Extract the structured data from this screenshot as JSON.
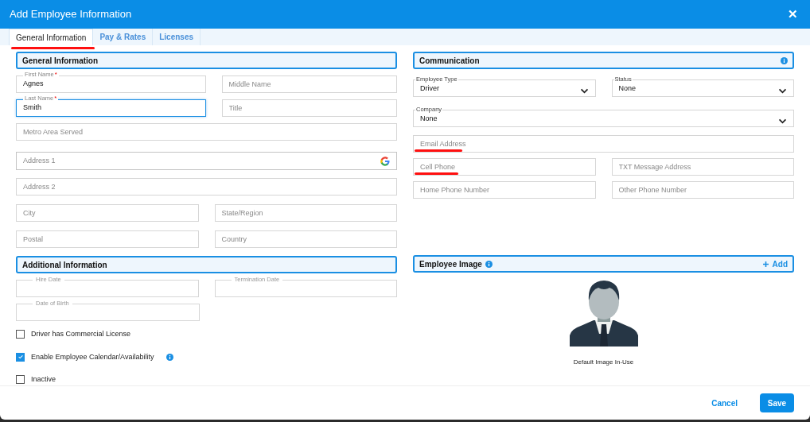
{
  "dialog": {
    "title": "Add Employee Information",
    "close": "✕"
  },
  "tabs": [
    {
      "label": "General Information",
      "selected": true,
      "marked": true
    },
    {
      "label": "Pay & Rates",
      "selected": false,
      "marked": false
    },
    {
      "label": "Licenses",
      "selected": false,
      "marked": false
    }
  ],
  "general": {
    "heading": "General Information",
    "rows": [
      [
        {
          "kind": "labeled",
          "label": "First Name",
          "value": "Agnes",
          "required_mark": "*",
          "focused": false
        },
        {
          "kind": "text",
          "placeholder": "Middle Name",
          "marked": false
        }
      ],
      [
        {
          "kind": "labeled",
          "label": "Last Name",
          "value": "Smith",
          "required_mark": "*",
          "focused": true
        },
        {
          "kind": "text",
          "placeholder": "Title",
          "marked": false
        }
      ],
      [
        {
          "kind": "text",
          "placeholder": "Metro Area Served",
          "marked": false
        }
      ],
      [
        {
          "kind": "lookup",
          "placeholder": "Address 1"
        }
      ],
      [
        {
          "kind": "text",
          "placeholder": "Address 2",
          "marked": false
        }
      ],
      [
        {
          "kind": "text",
          "placeholder": "City",
          "marked": false
        },
        {
          "kind": "text",
          "placeholder": "State/Region",
          "marked": false
        }
      ],
      [
        {
          "kind": "text",
          "placeholder": "Postal",
          "marked": false
        },
        {
          "kind": "text",
          "placeholder": "Country",
          "marked": false
        }
      ]
    ]
  },
  "communication": {
    "heading": "Communication",
    "rows": [
      [
        {
          "kind": "select",
          "label": "Employee Type",
          "value": "Driver"
        },
        {
          "kind": "select",
          "label": "Status",
          "value": "None"
        }
      ],
      [
        {
          "kind": "select",
          "label": "Company",
          "value": "None"
        }
      ],
      [
        {
          "kind": "text",
          "placeholder": "Email Address",
          "marked": true
        }
      ],
      [
        {
          "kind": "text",
          "placeholder": "Cell Phone",
          "marked": true
        },
        {
          "kind": "text",
          "placeholder": "TXT Message Address",
          "marked": false
        }
      ],
      [
        {
          "kind": "text",
          "placeholder": "Home Phone Number",
          "marked": false
        },
        {
          "kind": "text",
          "placeholder": "Other Phone Number",
          "marked": false
        }
      ]
    ]
  },
  "additional": {
    "heading": "Additional Information",
    "rows": [
      [
        {
          "kind": "date",
          "label": "Hire Date"
        },
        {
          "kind": "date",
          "label": "Termination Date"
        }
      ],
      [
        {
          "kind": "date",
          "label": "Date of Birth"
        }
      ]
    ],
    "checkboxes": [
      {
        "label": "Driver has Commercial License",
        "checked": false,
        "info": false
      },
      {
        "label": "Enable Employee Calendar/Availability",
        "checked": true,
        "info": true
      },
      {
        "label": "Inactive",
        "checked": false,
        "info": false
      }
    ]
  },
  "employee_image": {
    "heading": "Employee Image",
    "add": "Add",
    "caption": "Default Image In-Use"
  },
  "buttons": {
    "cancel": "Cancel",
    "save": "Save"
  }
}
